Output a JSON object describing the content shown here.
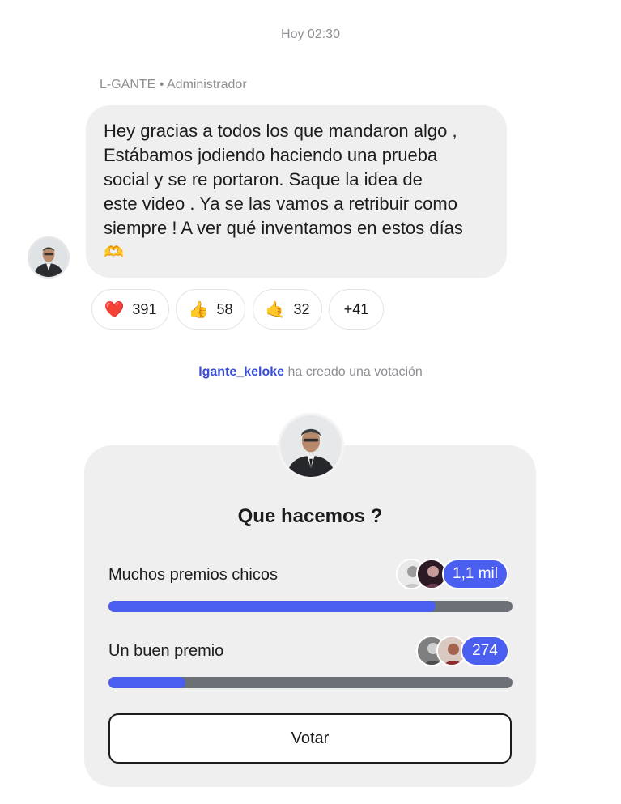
{
  "header": {
    "timestamp": "Hoy 02:30"
  },
  "message": {
    "sender": "L-GANTE",
    "role": "Administrador",
    "sender_line": "L-GANTE • Administrador",
    "text": "Hey gracias a todos los que mandaron algo ,\nEstábamos jodiendo haciendo una prueba\nsocial y se re portaron. Saque la idea de\neste video . Ya se las vamos a retribuir como\nsiempre ! A ver qué inventamos en estos días",
    "trailing_emoji": "🫶"
  },
  "reactions": [
    {
      "emoji": "❤️",
      "icon": "heart-icon",
      "count": "391"
    },
    {
      "emoji": "👍",
      "icon": "thumbs-up-icon",
      "count": "58"
    },
    {
      "emoji": "🤙",
      "icon": "call-me-hand-icon",
      "count": "32"
    },
    {
      "emoji": "",
      "icon": "",
      "count": "+41"
    }
  ],
  "system": {
    "username": "lgante_keloke",
    "action": " ha creado una votación"
  },
  "poll": {
    "question": "Que hacemos ?",
    "options": [
      {
        "label": "Muchos premios chicos",
        "votes": "1,1 mil",
        "fraction": 0.81
      },
      {
        "label": "Un buen premio",
        "votes": "274",
        "fraction": 0.19
      }
    ],
    "vote_button": "Votar"
  },
  "colors": {
    "accent": "#4a5ef0",
    "bubble": "#efeff0",
    "track": "#6c7177",
    "username": "#3a4bd6",
    "muted": "#8e8e93"
  }
}
